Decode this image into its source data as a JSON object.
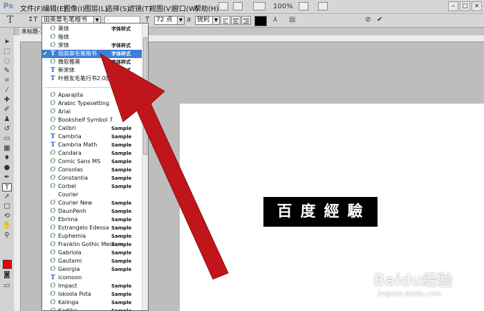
{
  "app": {
    "logo": "Ps"
  },
  "menubar": {
    "items": [
      "文件(F)",
      "编辑(E)",
      "图像(I)",
      "图层(L)",
      "选择(S)",
      "滤镜(T)",
      "视图(V)",
      "窗口(W)",
      "帮助(H)"
    ],
    "zoom": "100%"
  },
  "options": {
    "font_family": "田英章毛笔楷书",
    "font_style": "-",
    "font_size": "72 点",
    "anti_alias": "锐利",
    "text_color": "#000000"
  },
  "document": {
    "tab_title": "未标题-1",
    "text": "百度經驗"
  },
  "font_list": [
    {
      "icon": "O",
      "name": "黑体",
      "sample": "字体样式",
      "checked": false
    },
    {
      "icon": "O",
      "name": "楷体",
      "sample": "",
      "checked": false
    },
    {
      "icon": "O",
      "name": "宋体",
      "sample": "字体样式",
      "checked": false
    },
    {
      "icon": "T",
      "name": "田英章毛笔楷书",
      "sample": "字体样式",
      "checked": true,
      "selected": true
    },
    {
      "icon": "O",
      "name": "微软雅黑",
      "sample": "字体样式",
      "checked": false
    },
    {
      "icon": "T",
      "name": "新宋体",
      "sample": "字体样式",
      "checked": false
    },
    {
      "icon": "T",
      "name": "叶根友毛笔行书2.0版",
      "sample": "字体样式",
      "checked": false
    },
    {
      "icon": "O",
      "name": "Aparajita",
      "sample": "",
      "checked": false
    },
    {
      "icon": "O",
      "name": "Arabic Typesetting",
      "sample": "",
      "checked": false
    },
    {
      "icon": "O",
      "name": "Arial",
      "sample": "",
      "checked": false
    },
    {
      "icon": "O",
      "name": "Bookshelf Symbol 7",
      "sample": "",
      "checked": false
    },
    {
      "icon": "O",
      "name": "Calibri",
      "sample": "Sample",
      "checked": false
    },
    {
      "icon": "T",
      "name": "Cambria",
      "sample": "Sample",
      "checked": false
    },
    {
      "icon": "T",
      "name": "Cambria Math",
      "sample": "Sample",
      "checked": false
    },
    {
      "icon": "O",
      "name": "Candara",
      "sample": "Sample",
      "checked": false
    },
    {
      "icon": "O",
      "name": "Comic Sans MS",
      "sample": "Sample",
      "checked": false
    },
    {
      "icon": "O",
      "name": "Consolas",
      "sample": "Sample",
      "checked": false
    },
    {
      "icon": "O",
      "name": "Constantia",
      "sample": "Sample",
      "checked": false
    },
    {
      "icon": "O",
      "name": "Corbel",
      "sample": "Sample",
      "checked": false
    },
    {
      "icon": "",
      "name": "Courier",
      "sample": "",
      "checked": false
    },
    {
      "icon": "O",
      "name": "Courier New",
      "sample": "Sample",
      "checked": false
    },
    {
      "icon": "O",
      "name": "DaunPenh",
      "sample": "Sample",
      "checked": false
    },
    {
      "icon": "O",
      "name": "Ebrima",
      "sample": "Sample",
      "checked": false
    },
    {
      "icon": "O",
      "name": "Estrangelo Edessa",
      "sample": "Sample",
      "checked": false
    },
    {
      "icon": "O",
      "name": "Euphemia",
      "sample": "Sample",
      "checked": false
    },
    {
      "icon": "O",
      "name": "Franklin Gothic Medium",
      "sample": "Sample",
      "checked": false
    },
    {
      "icon": "O",
      "name": "Gabriola",
      "sample": "Sample",
      "checked": false
    },
    {
      "icon": "O",
      "name": "Gautami",
      "sample": "Sample",
      "checked": false
    },
    {
      "icon": "O",
      "name": "Georgia",
      "sample": "Sample",
      "checked": false
    },
    {
      "icon": "T",
      "name": "icomoon",
      "sample": "",
      "checked": false
    },
    {
      "icon": "O",
      "name": "Impact",
      "sample": "Sample",
      "checked": false
    },
    {
      "icon": "O",
      "name": "Iskoola Pota",
      "sample": "Sample",
      "checked": false
    },
    {
      "icon": "O",
      "name": "Kalinga",
      "sample": "Sample",
      "checked": false
    },
    {
      "icon": "O",
      "name": "Kartika",
      "sample": "Sample",
      "checked": false
    }
  ],
  "watermark": {
    "main": "Baidu经验",
    "sub": "jingyan.baidu.com"
  },
  "colors": {
    "selection": "#3d7fd6",
    "arrow": "#c0161b",
    "foreground": "#ee0000"
  }
}
